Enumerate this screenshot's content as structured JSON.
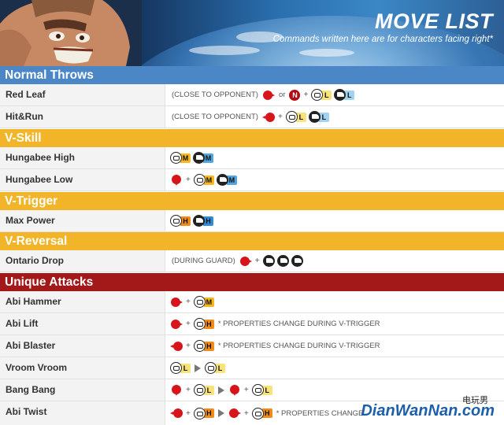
{
  "header": {
    "title": "MOVE LIST",
    "subtitle": "Commands written here are for characters facing right*"
  },
  "sections": {
    "normal_throws": "Normal Throws",
    "v_skill": "V-Skill",
    "v_trigger": "V-Trigger",
    "v_reversal": "V-Reversal",
    "unique_attacks": "Unique Attacks"
  },
  "moves": {
    "red_leaf": {
      "name": "Red Leaf",
      "prefix": "(CLOSE TO OPPONENT)",
      "or": "or"
    },
    "hit_and_run": {
      "name": "Hit&Run",
      "prefix": "(CLOSE TO OPPONENT)"
    },
    "hungabee_high": {
      "name": "Hungabee High"
    },
    "hungabee_low": {
      "name": "Hungabee Low"
    },
    "max_power": {
      "name": "Max Power"
    },
    "ontario_drop": {
      "name": "Ontario Drop",
      "prefix": "(DURING GUARD)"
    },
    "abi_hammer": {
      "name": "Abi Hammer"
    },
    "abi_lift": {
      "name": "Abi Lift",
      "note": "* PROPERTIES CHANGE DURING V-TRIGGER"
    },
    "abi_blaster": {
      "name": "Abi Blaster",
      "note": "* PROPERTIES CHANGE DURING V-TRIGGER"
    },
    "vroom_vroom": {
      "name": "Vroom Vroom"
    },
    "bang_bang": {
      "name": "Bang Bang"
    },
    "abi_twist": {
      "name": "Abi Twist",
      "note": "* PROPERTIES CHANGE"
    }
  },
  "labels": {
    "plus": "+",
    "neutral": "N",
    "L": "L",
    "M": "M",
    "H": "H"
  },
  "watermark": {
    "en": "DianWanNan.com",
    "cn": "电玩男"
  },
  "colors": {
    "blue_section": "#4b87c6",
    "yellow_section": "#f2b52a",
    "red_section": "#a31818",
    "direction_red": "#d8141b"
  }
}
